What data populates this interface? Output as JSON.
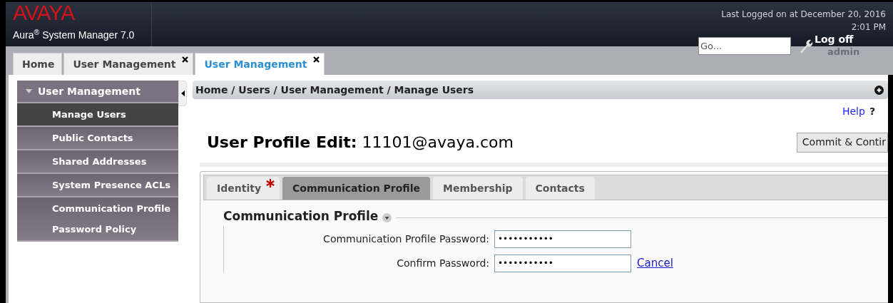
{
  "header": {
    "logo": "AVAYA",
    "product": "Aura$^{®}$ System Manager 7.0",
    "last_logged": "Last Logged on at December 20, 2016",
    "time": "2:01 PM",
    "search": {
      "placeholder": "Go..."
    },
    "logoff": "Log off",
    "user": "admin"
  },
  "tabs": [
    {
      "label": "Home",
      "selected": false,
      "closable": false
    },
    {
      "label": "User Management",
      "selected": false,
      "closable": true
    },
    {
      "label": "User Management",
      "selected": true,
      "closable": true
    }
  ],
  "sidebar": {
    "title": "User Management",
    "expanded": true,
    "items": [
      {
        "label": "Manage Users",
        "selected": true
      },
      {
        "label": "Public Contacts",
        "selected": false
      },
      {
        "label": "Shared Addresses",
        "selected": false
      },
      {
        "label": "System Presence ACLs",
        "selected": false
      },
      {
        "label": "Communication Profile Password Policy",
        "selected": false
      }
    ]
  },
  "breadcrumb": "Home / Users / User Management / Manage Users",
  "help": "Help",
  "help_mark": "?",
  "page_title": "**User Profile Edit:** 11101@avaya.com",
  "commit_button": "Commit & Contir",
  "profile_tabs": [
    {
      "label": "Identity",
      "selected": false,
      "required": true
    },
    {
      "label": "Communication Profile",
      "selected": true,
      "required": false
    },
    {
      "label": "Membership",
      "selected": false,
      "required": false
    },
    {
      "label": "Contacts",
      "selected": false,
      "required": false
    }
  ],
  "section": {
    "title": "Communication Profile",
    "fields": [
      {
        "label": "Communication Profile Password:",
        "value": "•••••••••••"
      },
      {
        "label": "Confirm Password:",
        "value": "•••••••••••",
        "link": "Cancel"
      }
    ]
  }
}
